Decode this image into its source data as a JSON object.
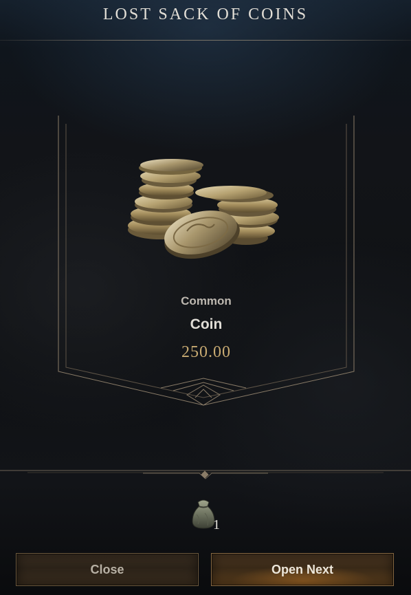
{
  "window": {
    "title": "LOST SACK OF COINS"
  },
  "reward": {
    "rarity": "Common",
    "name": "Coin",
    "value": "250.00",
    "icon": "coin-stack-icon"
  },
  "queue": {
    "icon": "coin-sack-icon",
    "count": "1"
  },
  "buttons": {
    "close_label": "Close",
    "open_next_label": "Open Next"
  },
  "colors": {
    "value_gold": "#c9ab72",
    "frame_line": "#8a7c68",
    "button_border": "#6e5a3e"
  }
}
